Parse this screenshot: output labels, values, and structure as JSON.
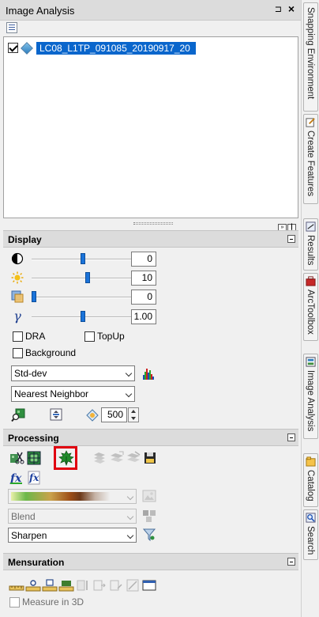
{
  "window": {
    "title": "Image Analysis",
    "pin_glyph": "⊐",
    "close_glyph": "×"
  },
  "layers": [
    {
      "name": "LC08_L1TP_091085_20190917_20",
      "checked": true
    }
  ],
  "mini_buttons": [
    "»",
    "┃"
  ],
  "display": {
    "title": "Display",
    "sliders": [
      {
        "id": "contrast",
        "icon": "contrast-icon",
        "value": "0",
        "level": 0.5
      },
      {
        "id": "brightness",
        "icon": "brightness-icon",
        "value": "10",
        "level": 0.55
      },
      {
        "id": "transparency",
        "icon": "transparency-icon",
        "value": "0",
        "level": 0.0
      },
      {
        "id": "gamma",
        "icon": "gamma-icon",
        "value": "1.00",
        "level": 0.5
      }
    ],
    "gamma_symbol": "γ",
    "checks": [
      {
        "label": "DRA",
        "checked": false
      },
      {
        "label": "TopUp",
        "checked": false
      },
      {
        "label": "Background",
        "checked": false
      }
    ],
    "stretch": "Std-dev",
    "resampling": "Nearest Neighbor",
    "dpi_value": "500"
  },
  "processing": {
    "title": "Processing",
    "colormap_dropdown": "",
    "blend": "Blend",
    "sharpen": "Sharpen"
  },
  "mensuration": {
    "title": "Mensuration",
    "measure_3d": "Measure in 3D"
  },
  "dock_tabs": [
    {
      "label": "Snapping Environment"
    },
    {
      "label": "Create Features"
    },
    {
      "label": "Results"
    },
    {
      "label": "ArcToolbox"
    },
    {
      "label": "Image Analysis"
    },
    {
      "label": "Catalog"
    },
    {
      "label": "Search"
    }
  ],
  "colors": {
    "accent": "#0a66cc",
    "slider_thumb": "#1a73d9",
    "highlight": "#e0000f"
  }
}
